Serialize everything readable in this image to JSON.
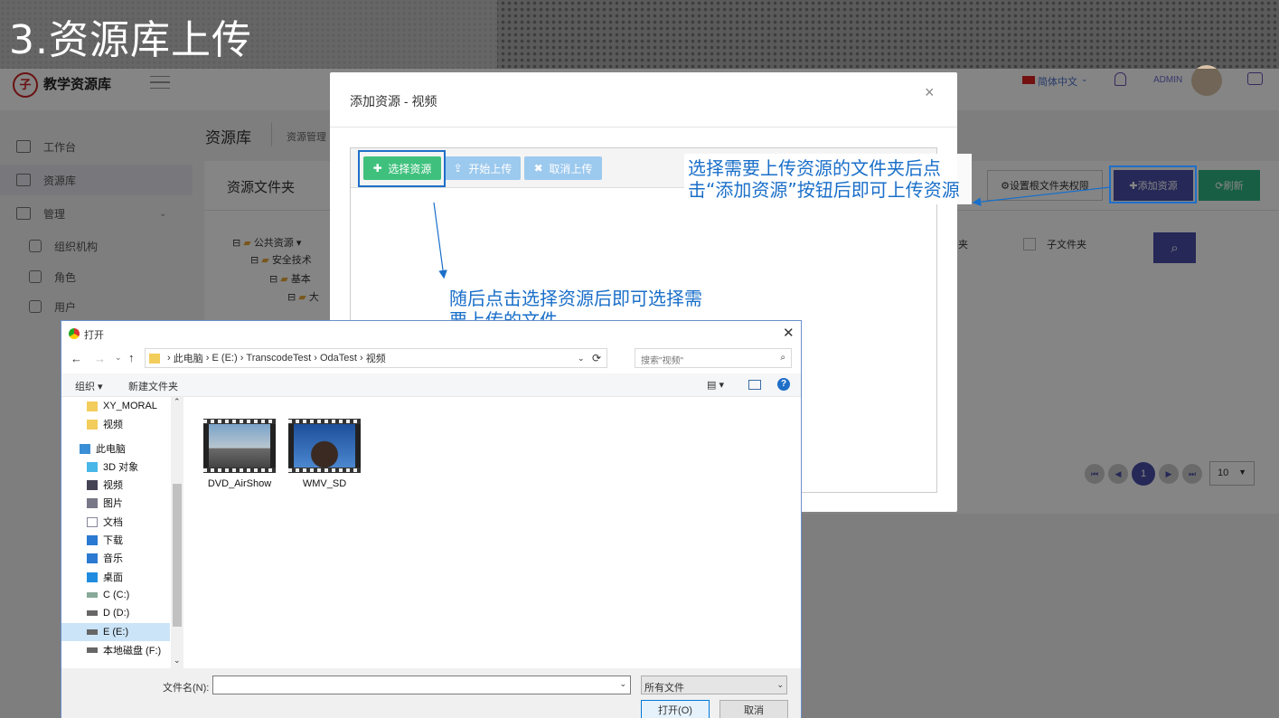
{
  "slide": {
    "title": "3.资源库上传"
  },
  "app": {
    "logo_text": "教学资源库",
    "header": {
      "language": "简体中文",
      "user": "ADMIN"
    },
    "sidebar": [
      {
        "label": "工作台",
        "icon": "dashboard-icon"
      },
      {
        "label": "资源库",
        "icon": "folder-icon"
      },
      {
        "label": "管理",
        "icon": "manage-icon"
      },
      {
        "label": "组织机构",
        "icon": "org-icon"
      },
      {
        "label": "角色",
        "icon": "role-icon"
      },
      {
        "label": "用户",
        "icon": "user-icon"
      }
    ],
    "breadcrumb": {
      "main": "资源库",
      "sub": "资源管理"
    },
    "panel_title": "资源文件夹",
    "tree": [
      "公共资源",
      "安全技术",
      "基本",
      "大"
    ],
    "buttons": {
      "set_perm": "设置根文件夹权限",
      "add_resource": "添加资源",
      "refresh": "刷新"
    },
    "filter": {
      "folder_label": "夹",
      "subfolder_label": "子文件夹"
    },
    "pagination": {
      "current": "1",
      "page_size": "10"
    }
  },
  "modal": {
    "title": "添加资源 - 视频",
    "close": "×",
    "toolbar": {
      "select": "选择资源",
      "start": "开始上传",
      "cancel": "取消上传"
    }
  },
  "file_dialog": {
    "title": "打开",
    "path": [
      "此电脑",
      "E (E:)",
      "TranscodeTest",
      "OdaTest",
      "视频"
    ],
    "search_placeholder": "搜索\"视频\"",
    "cmd": {
      "organize": "组织",
      "new_folder": "新建文件夹"
    },
    "nav": [
      "XY_MORAL",
      "视频",
      "此电脑",
      "3D 对象",
      "视频",
      "图片",
      "文档",
      "下载",
      "音乐",
      "桌面",
      "C (C:)",
      "D (D:)",
      "E (E:)",
      "本地磁盘 (F:)"
    ],
    "files": [
      "DVD_AirShow",
      "WMV_SD"
    ],
    "filename_label": "文件名(N):",
    "filetype": "所有文件",
    "open": "打开(O)",
    "cancel": "取消"
  },
  "annotations": {
    "right": "选择需要上传资源的文件夹后点击“添加资源”按钮后即可上传资源",
    "middle": "随后点击选择资源后即可选择需要上传的文件"
  },
  "colors": {
    "accent": "#4a4ea8",
    "green": "#2fb584",
    "select_green": "#3fc17d",
    "annot_blue": "#1a6fc9"
  }
}
